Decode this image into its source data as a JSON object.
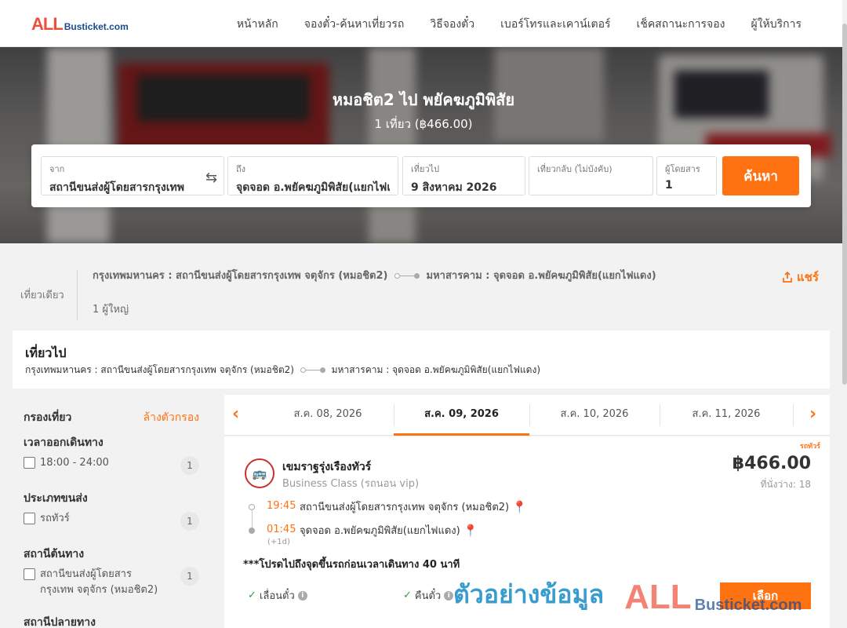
{
  "header": {
    "logo_all": "ALL",
    "logo_rest": "Busticket.com",
    "nav": [
      "หน้าหลัก",
      "จองตั๋ว-ค้นหาเที่ยวรถ",
      "วิธีจองตั๋ว",
      "เบอร์โทรและเคาน์เตอร์",
      "เช็คสถานะการจอง",
      "ผู้ให้บริการ"
    ]
  },
  "hero": {
    "title": "หมอชิต2 ไป พยัคฆภูมิพิสัย",
    "subtitle": "1 เที่ยว (฿466.00)"
  },
  "search": {
    "from_label": "จาก",
    "from_value": "สถานีขนส่งผู้โดยสารกรุงเทพ",
    "to_label": "ถึง",
    "to_value": "จุดจอด อ.พยัคฆภูมิพิสัย(แยกไฟแดง)",
    "depart_label": "เที่ยวไป",
    "depart_value": "9 สิงหาคม 2026",
    "return_label": "เที่ยวกลับ (ไม่บังคับ)",
    "return_value": "",
    "pax_label": "ผู้โดยสาร",
    "pax_value": "1",
    "button": "ค้นหา",
    "swap_icon": "swap-arrows-icon"
  },
  "summary": {
    "trip_type": "เที่ยวเดียว",
    "origin": "กรุงเทพมหานคร : สถานีขนส่งผู้โดยสารกรุงเทพ จตุจักร (หมอชิต2)",
    "destination": "มหาสารคาม : จุดจอด อ.พยัคฆภูมิพิสัย(แยกไฟแดง)",
    "passengers": "1 ผู้ใหญ่",
    "share": "แชร์"
  },
  "outbound": {
    "title": "เที่ยวไป",
    "origin": "กรุงเทพมหานคร : สถานีขนส่งผู้โดยสารกรุงเทพ จตุจักร (หมอชิต2)",
    "destination": "มหาสารคาม : จุดจอด อ.พยัคฆภูมิพิสัย(แยกไฟแดง)"
  },
  "filters": {
    "title": "กรองเที่ยว",
    "clear": "ล้างตัวกรอง",
    "sections": [
      {
        "title": "เวลาออกเดินทาง",
        "option": "18:00 - 24:00",
        "count": "1"
      },
      {
        "title": "ประเภทขนส่ง",
        "option": "รถทัวร์",
        "count": "1"
      },
      {
        "title": "สถานีต้นทาง",
        "option": "สถานีขนส่งผู้โดยสารกรุงเทพ จตุจักร (หมอชิต2)",
        "count": "1"
      },
      {
        "title": "สถานีปลายทาง"
      }
    ]
  },
  "dates": [
    "ส.ค. 08, 2026",
    "ส.ค. 09, 2026",
    "ส.ค. 10, 2026",
    "ส.ค. 11, 2026"
  ],
  "trip": {
    "badge": "รถทัวร์",
    "operator": "เขมราฐรุ่งเรืองทัวร์",
    "bus_class": "Business Class (รถนอน vip)",
    "price": "฿466.00",
    "seats": "ที่นั่งว่าง: 18",
    "depart_time": "19:45",
    "depart_station": "สถานีขนส่งผู้โดยสารกรุงเทพ จตุจักร (หมอชิต2)",
    "arrive_time": "01:45",
    "arrive_station": "จุดจอด อ.พยัคฆภูมิพิสัย(แยกไฟแดง)",
    "next_day": "(+1d)",
    "notice": "***โปรดไปถึงจุดขึ้นรถก่อนเวลาเดินทาง 40 นาที",
    "feature1": "เลื่อนตั๋ว",
    "feature2": "คืนตั๋ว",
    "select_button": "เลือก"
  },
  "watermark": {
    "thai": "ตัวอย่างข้อมูล",
    "all": "ALL",
    "busticket": "Busticket.com"
  },
  "colors": {
    "accent": "#ff7211",
    "logo_red": "#f04e3c",
    "logo_blue": "#1c4b8f"
  }
}
